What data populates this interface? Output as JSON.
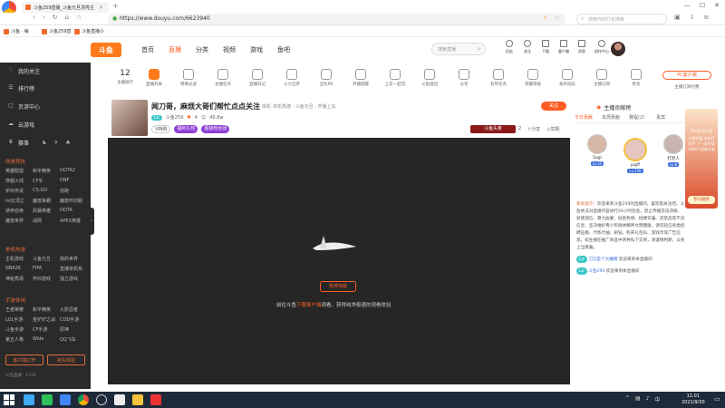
{
  "browser": {
    "tab_title": "斗鱼259直播_斗鱼元旦漂亮主",
    "url": "https://www.douyu.com/6623940",
    "search_placeholder": "搜索你的行实搜索",
    "bookmarks": [
      "斗鱼 · 每",
      "斗鱼259直",
      "斗鱼直播小"
    ]
  },
  "site": {
    "logo": "斗鱼",
    "nav": [
      "首页",
      "直播",
      "分类",
      "视频",
      "游戏",
      "鱼吧"
    ],
    "active_nav": "直播",
    "search_placeholder": "搜索直播",
    "header_icons": [
      "历史",
      "关注",
      "下载",
      "客户端",
      "消息",
      "创作中心"
    ]
  },
  "sidebar": {
    "top_items": [
      {
        "icon": "heart-icon",
        "label": "我的关注"
      },
      {
        "icon": "list-icon",
        "label": "排行榜"
      },
      {
        "icon": "video-icon",
        "label": "页游中心"
      },
      {
        "icon": "cloud-icon",
        "label": "云游戏"
      },
      {
        "icon": "trophy-icon",
        "label": "赛事"
      }
    ],
    "sections": [
      {
        "title": "网游竞技",
        "items": [
          "英雄联盟",
          "和平精英",
          "DOTA2",
          "穿越火线",
          "CF手",
          "DNF",
          "炉石传说",
          "CS:GO",
          "逃跑",
          "lol云顶之",
          "魔兽争霸",
          "魔兽怀旧服",
          "使命召唤",
          "风暴英雄",
          "DOTA",
          "魔兽世界",
          "战网",
          "APEX英雄"
        ]
      },
      {
        "title": "单机热游",
        "items": [
          "主机游戏",
          "斗鱼元旦",
          "我的世界",
          "NBA2K",
          "FIFA",
          "直播单机热",
          "神秘秀场",
          "怀旧游戏",
          "独立游戏"
        ]
      },
      {
        "title": "手游休闲",
        "items": [
          "王者荣耀",
          "和平精英",
          "火影忍者",
          "LOL手游",
          "金铲铲之战",
          "COD手游",
          "斗鱼手游",
          "CF手游",
          "原神",
          "第五人格",
          "Wide",
          "QQ飞车"
        ]
      }
    ],
    "bottom_buttons": [
      "客户端打开",
      "抢先体验"
    ],
    "footer": "斗鱼直播 · 1316"
  },
  "categories": [
    "主播排行",
    "直播开关",
    "特殊光波",
    "主播任务",
    "直播日记",
    "火力全开",
    "全民PK",
    "开播提醒",
    "上车一起玩",
    "斗鱼组团",
    "分享",
    "有奖任务",
    "荣耀等级",
    "发布动态",
    "主播订阅",
    "更多",
    "PC客户端",
    "主播订阅付费"
  ],
  "categories_count": "12",
  "stream": {
    "title": "闻刀哥，麻烦大哥们帮忙点点关注",
    "tag": "单机",
    "breadcrumb": "单机热游 · 斗鱼元旦 · 开播上车",
    "room_label": "斗鱼259",
    "level": "4",
    "follow_count": "49.8w",
    "follow_button": "关注",
    "badges": [
      "V特购",
      "福利礼包",
      "超级粉丝团"
    ],
    "anchor_btn": "斗鱼头条",
    "sub_count": "2",
    "actions": [
      "分享",
      "举报"
    ]
  },
  "player": {
    "status_button": "暂停加载",
    "hint_prefix": "前往斗鱼",
    "hint_link": "下载客户端",
    "hint_suffix": "观看，获得纯净极速的观看体验"
  },
  "rightpanel": {
    "tabs": [
      "今日贡献",
      "本周贡献",
      "赛程(2)",
      "贵宾"
    ],
    "header": "主播贡献榜",
    "top_users": [
      {
        "name": "Sagi",
        "level": "Lv.25"
      },
      {
        "name": "pigff",
        "level": "Lv.156"
      },
      {
        "name": "打赏人",
        "level": "Lv.8"
      }
    ],
    "chat": [
      {
        "name": "系统提示：",
        "text": "欢迎来到斗鱼259的直播间，喜欢就关注吧。斗鱼依法对直播内容进行24小时巡查，禁止传播违法违规、封建迷信、暴力血腥、低俗色情、招嫖诈骗、违禁品等不良信息，坚决维护青少年群体精神文明健康。请勿轻信各类招聘征婚、代练代抽、刷钻、购买礼包码、游戏币等广告信息。如主播在推广商品中诱导私下交易，请谨慎判断，以免上当受骗。"
      },
      {
        "name": "刀刀是个大睡猪",
        "text": "欢迎来到本直播间"
      },
      {
        "name": "斗鱼259",
        "text": "欢迎来到本直播间"
      }
    ],
    "ad_text": "斗鱼好看 本场开奖中 下一场开奖 1000个奖励礼包",
    "ad_time": "18:00-12:00",
    "ad_btn": "参与抽奖"
  },
  "taskbar": {
    "time": "11:01",
    "date": "2021/9/30",
    "lang": "中"
  }
}
